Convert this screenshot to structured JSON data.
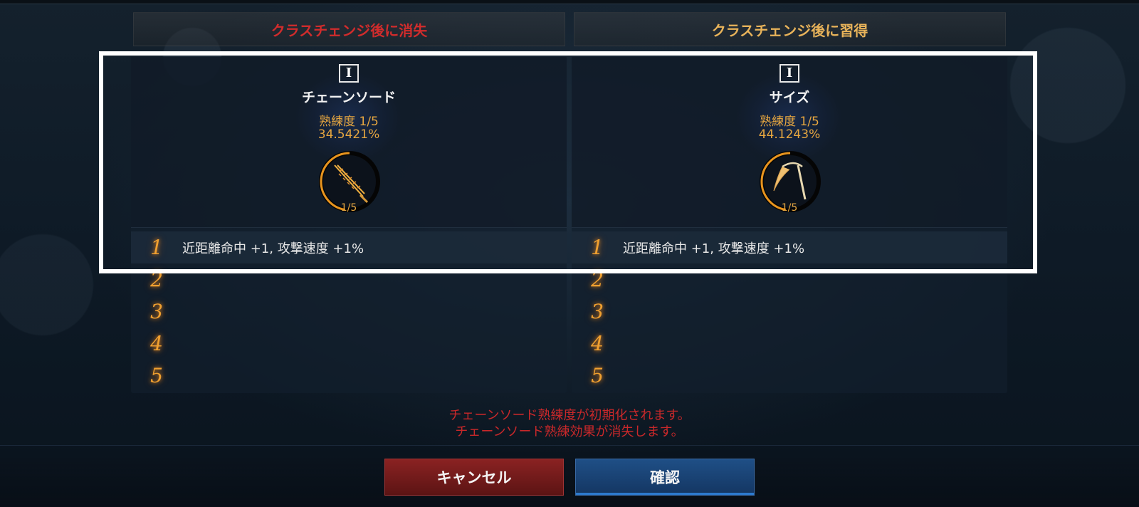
{
  "columns": {
    "lost_header": "クラスチェンジ後に消失",
    "gained_header": "クラスチェンジ後に習得"
  },
  "left": {
    "tier": "I",
    "weapon_name": "チェーンソード",
    "proficiency": "熟練度 1/5",
    "percent": "34.5421%",
    "ring_level": "1/5",
    "ring_progress": 0.2,
    "icon": "chainsword-icon",
    "rows": [
      {
        "num": "1",
        "text": "近距離命中 +1, 攻撃速度 +1%"
      },
      {
        "num": "2",
        "text": ""
      },
      {
        "num": "3",
        "text": ""
      },
      {
        "num": "4",
        "text": ""
      },
      {
        "num": "5",
        "text": ""
      }
    ]
  },
  "right": {
    "tier": "I",
    "weapon_name": "サイズ",
    "proficiency": "熟練度 1/5",
    "percent": "44.1243%",
    "ring_level": "1/5",
    "ring_progress": 0.2,
    "icon": "scythe-icon",
    "rows": [
      {
        "num": "1",
        "text": "近距離命中 +1, 攻撃速度 +1%"
      },
      {
        "num": "2",
        "text": ""
      },
      {
        "num": "3",
        "text": ""
      },
      {
        "num": "4",
        "text": ""
      },
      {
        "num": "5",
        "text": ""
      }
    ]
  },
  "notice": {
    "line1": "チェーンソード熟練度が初期化されます。",
    "line2": "チェーンソード熟練効果が消失します。"
  },
  "buttons": {
    "cancel": "キャンセル",
    "confirm": "確認"
  },
  "colors": {
    "lost_header": "#d12c2c",
    "gained_header": "#e8b35a",
    "accent_orange": "#e6a640",
    "cancel_red": "#8a2222",
    "confirm_blue": "#1f4f86"
  }
}
